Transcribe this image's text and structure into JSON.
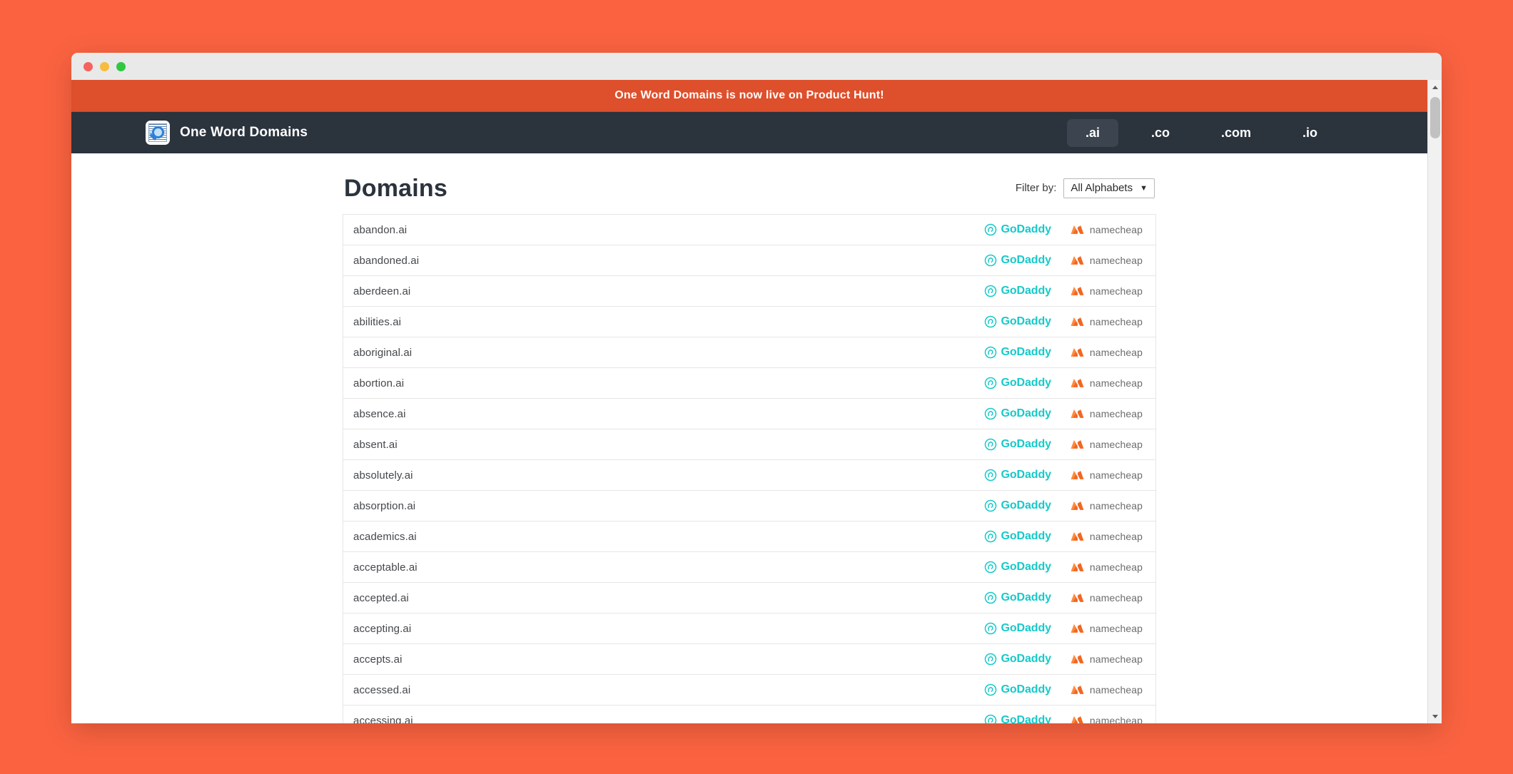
{
  "window": {
    "traffic_lights": [
      "close",
      "minimize",
      "maximize"
    ]
  },
  "promo": {
    "text": "One Word Domains is now live on Product Hunt!"
  },
  "navbar": {
    "brand_name": "One Word Domains",
    "logo_icon": "document-magnifier-icon",
    "tabs": [
      {
        "label": ".ai",
        "active": true
      },
      {
        "label": ".co",
        "active": false
      },
      {
        "label": ".com",
        "active": false
      },
      {
        "label": ".io",
        "active": false
      }
    ]
  },
  "main": {
    "title": "Domains",
    "filter": {
      "label": "Filter by:",
      "selected": "All Alphabets",
      "caret": "▼"
    },
    "registrar_labels": {
      "godaddy": "GoDaddy",
      "namecheap": "namecheap"
    },
    "domains": [
      "abandon.ai",
      "abandoned.ai",
      "aberdeen.ai",
      "abilities.ai",
      "aboriginal.ai",
      "abortion.ai",
      "absence.ai",
      "absent.ai",
      "absolutely.ai",
      "absorption.ai",
      "academics.ai",
      "acceptable.ai",
      "accepted.ai",
      "accepting.ai",
      "accepts.ai",
      "accessed.ai",
      "accessing.ai"
    ]
  },
  "colors": {
    "page_background": "#fb6340",
    "promo_background": "#de4f2c",
    "navbar_background": "#2b333d",
    "godaddy_teal": "#17c9c9",
    "namecheap_orange": "#f26722",
    "title_dark": "#2b333d"
  },
  "scrollbar": {
    "up_arrow": "scroll-up-arrow",
    "down_arrow": "scroll-down-arrow"
  }
}
